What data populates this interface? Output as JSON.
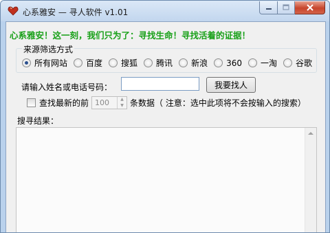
{
  "window": {
    "title": "心系雅安 — 寻人软件 v1.01",
    "accent": "#18a018"
  },
  "slogan": "心系雅安！这一刻，我们只为了：寻找生命！寻找活着的证据！",
  "source_group": {
    "legend": "来源筛选方式",
    "options": [
      {
        "label": "所有网站",
        "checked": true
      },
      {
        "label": "百度",
        "checked": false
      },
      {
        "label": "搜狐",
        "checked": false
      },
      {
        "label": "腾讯",
        "checked": false
      },
      {
        "label": "新浪",
        "checked": false
      },
      {
        "label": "360",
        "checked": false
      },
      {
        "label": "一淘",
        "checked": false
      },
      {
        "label": "谷歌",
        "checked": false
      }
    ]
  },
  "search": {
    "label": "请输入姓名或电话号码：",
    "value": "",
    "button": "我要找人"
  },
  "latest": {
    "prefix": "查找最新的前",
    "count": "100",
    "suffix": "条数据（ 注意：选中此项将不会按输入的搜索）"
  },
  "results": {
    "label": "搜寻结果："
  },
  "icons": {
    "app": "heart-icon",
    "minimize": "minimize-icon",
    "maximize": "maximize-icon",
    "close": "close-icon"
  }
}
